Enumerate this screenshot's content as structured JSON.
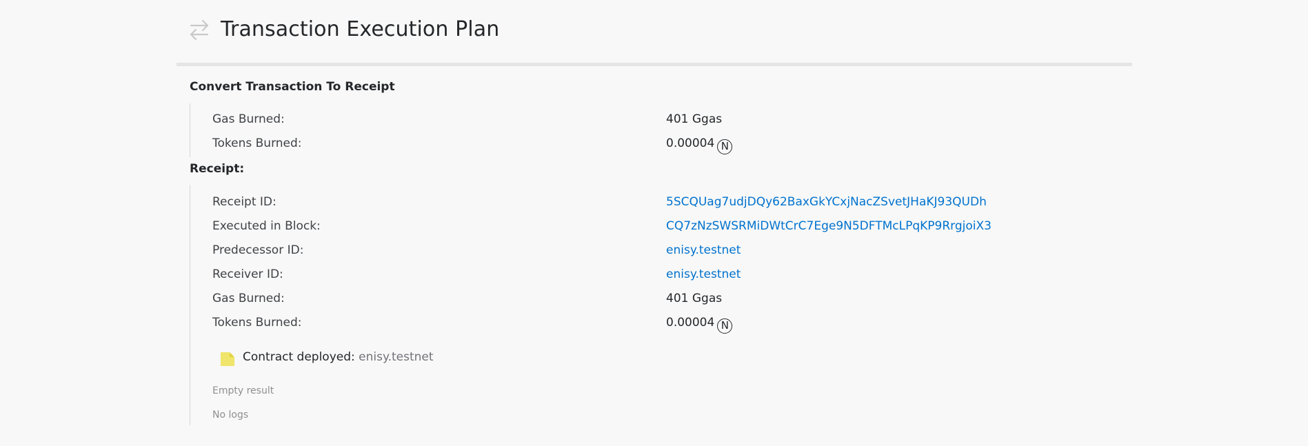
{
  "header": {
    "title": "Transaction Execution Plan",
    "icon": "transfer-arrows-icon"
  },
  "convert_section": {
    "title": "Convert Transaction To Receipt",
    "rows": [
      {
        "label": "Gas Burned:",
        "value": "401 Ggas"
      },
      {
        "label": "Tokens Burned:",
        "value": "0.00004"
      }
    ]
  },
  "receipt_section": {
    "title": "Receipt:",
    "rows": [
      {
        "label": "Receipt ID:",
        "value": "5SCQUag7udjDQy62BaxGkYCxjNacZSvetJHaKJ93QUDh"
      },
      {
        "label": "Executed in Block:",
        "value": "CQ7zNzSWSRMiDWtCrC7Ege9N5DFTMcLPqKP9RrgjoiX3"
      },
      {
        "label": "Predecessor ID:",
        "value": "enisy.testnet"
      },
      {
        "label": "Receiver ID:",
        "value": "enisy.testnet"
      },
      {
        "label": "Gas Burned:",
        "value": "401 Ggas"
      },
      {
        "label": "Tokens Burned:",
        "value": "0.00004"
      }
    ],
    "action": {
      "label": "Contract deployed:",
      "value": "enisy.testnet",
      "icon": "file-icon"
    },
    "result": "Empty result",
    "logs": "No logs"
  },
  "near_symbol": "N",
  "colors": {
    "link": "#0072ce",
    "action_icon": "#f0e56a",
    "rule": "#e5e5e5"
  }
}
